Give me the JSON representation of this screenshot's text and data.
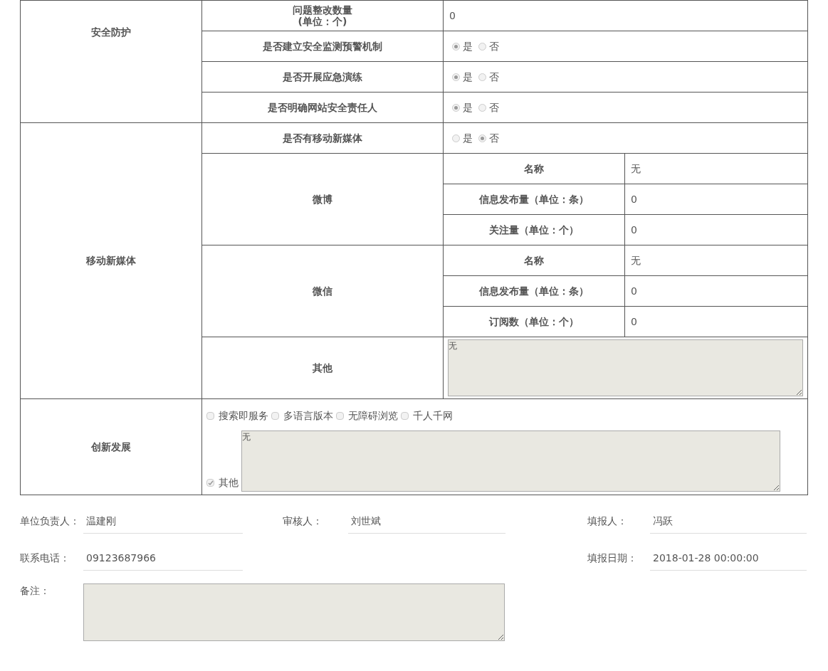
{
  "sections": [
    {
      "label": "安全防护",
      "rows": [
        {
          "kind": "text",
          "label": "问题整改数量\n(单位：个)",
          "value": "0"
        },
        {
          "kind": "radio",
          "label": "是否建立安全监测预警机制",
          "options": [
            {
              "label": "是",
              "selected": true
            },
            {
              "label": "否",
              "selected": false
            }
          ]
        },
        {
          "kind": "radio",
          "label": "是否开展应急演练",
          "options": [
            {
              "label": "是",
              "selected": true
            },
            {
              "label": "否",
              "selected": false
            }
          ]
        },
        {
          "kind": "radio",
          "label": "是否明确网站安全责任人",
          "options": [
            {
              "label": "是",
              "selected": true
            },
            {
              "label": "否",
              "selected": false
            }
          ]
        }
      ]
    },
    {
      "label": "移动新媒体",
      "rows": [
        {
          "kind": "radio",
          "label": "是否有移动新媒体",
          "options": [
            {
              "label": "是",
              "selected": false
            },
            {
              "label": "否",
              "selected": true
            }
          ]
        },
        {
          "kind": "group",
          "label": "微博",
          "items": [
            {
              "label": "名称",
              "value": "无"
            },
            {
              "label": "信息发布量（单位：条）",
              "value": "0"
            },
            {
              "label": "关注量（单位：个）",
              "value": "0"
            }
          ]
        },
        {
          "kind": "group",
          "label": "微信",
          "items": [
            {
              "label": "名称",
              "value": "无"
            },
            {
              "label": "信息发布量（单位：条）",
              "value": "0"
            },
            {
              "label": "订阅数（单位：个）",
              "value": "0"
            }
          ]
        },
        {
          "kind": "textarea",
          "label": "其他",
          "value": "无"
        }
      ]
    }
  ],
  "innovation": {
    "label": "创新发展",
    "options": [
      {
        "label": "搜索即服务",
        "checked": false
      },
      {
        "label": "多语言版本",
        "checked": false
      },
      {
        "label": "无障碍浏览",
        "checked": false
      },
      {
        "label": "千人千网",
        "checked": false
      }
    ],
    "other": {
      "label": "其他",
      "checked": true,
      "value": "无"
    }
  },
  "footer": {
    "row1": [
      {
        "label": "单位负责人：",
        "value": "温建刚"
      },
      {
        "label": "审核人：",
        "value": "刘世斌"
      },
      {
        "label": "填报人：",
        "value": "冯跃"
      }
    ],
    "row2": [
      {
        "label": "联系电话：",
        "value": "09123687966"
      },
      {
        "label": "填报日期：",
        "value": "2018-01-28 00:00:00"
      }
    ],
    "remarks": {
      "label": "备注："
    }
  }
}
